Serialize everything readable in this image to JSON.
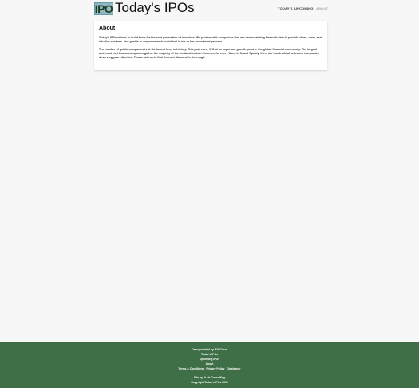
{
  "header": {
    "logo_text": "IPO",
    "title": "Today's IPOs"
  },
  "nav": {
    "items": [
      {
        "label": "TODAY'S"
      },
      {
        "label": "UPCOMING"
      },
      {
        "label": "ABOUT"
      }
    ]
  },
  "about": {
    "heading": "About",
    "paragraph1": "Today's IPOs strives to build tools for the next generation of investors. We partner with companies that are democratizing financial data to provide clean, clear, and intuitive systems. Our goal is to empower each individual in his or her investment process.",
    "paragraph2": "The number of public companies is at the lowest level in history. This puts every IPO at an important growth point in the global financial community. The largest and most well known companies gather the majority of the media attention. However, for every Uber, Lyft, and Spotify, there are hundreds of unknown companies deserving your attention. Please join us to find the next diamond in the rough."
  },
  "footer": {
    "data_provided": "Data provided by IEX Cloud",
    "link_todays": "Today's IPOs",
    "link_upcoming": "Upcoming IPOs",
    "link_about": "About",
    "link_terms": "Terms & Conditions",
    "link_privacy": "Privacy Policy",
    "link_disclaimer": "Disclaimer",
    "site_by": "Site by ALob Consulting",
    "copyright": "Copyright Today's IPOs 2019"
  },
  "colors": {
    "footer_bg": "#3f6f47",
    "logo_bg": "#8fb8c2",
    "page_bg": "#f7f7f7"
  }
}
